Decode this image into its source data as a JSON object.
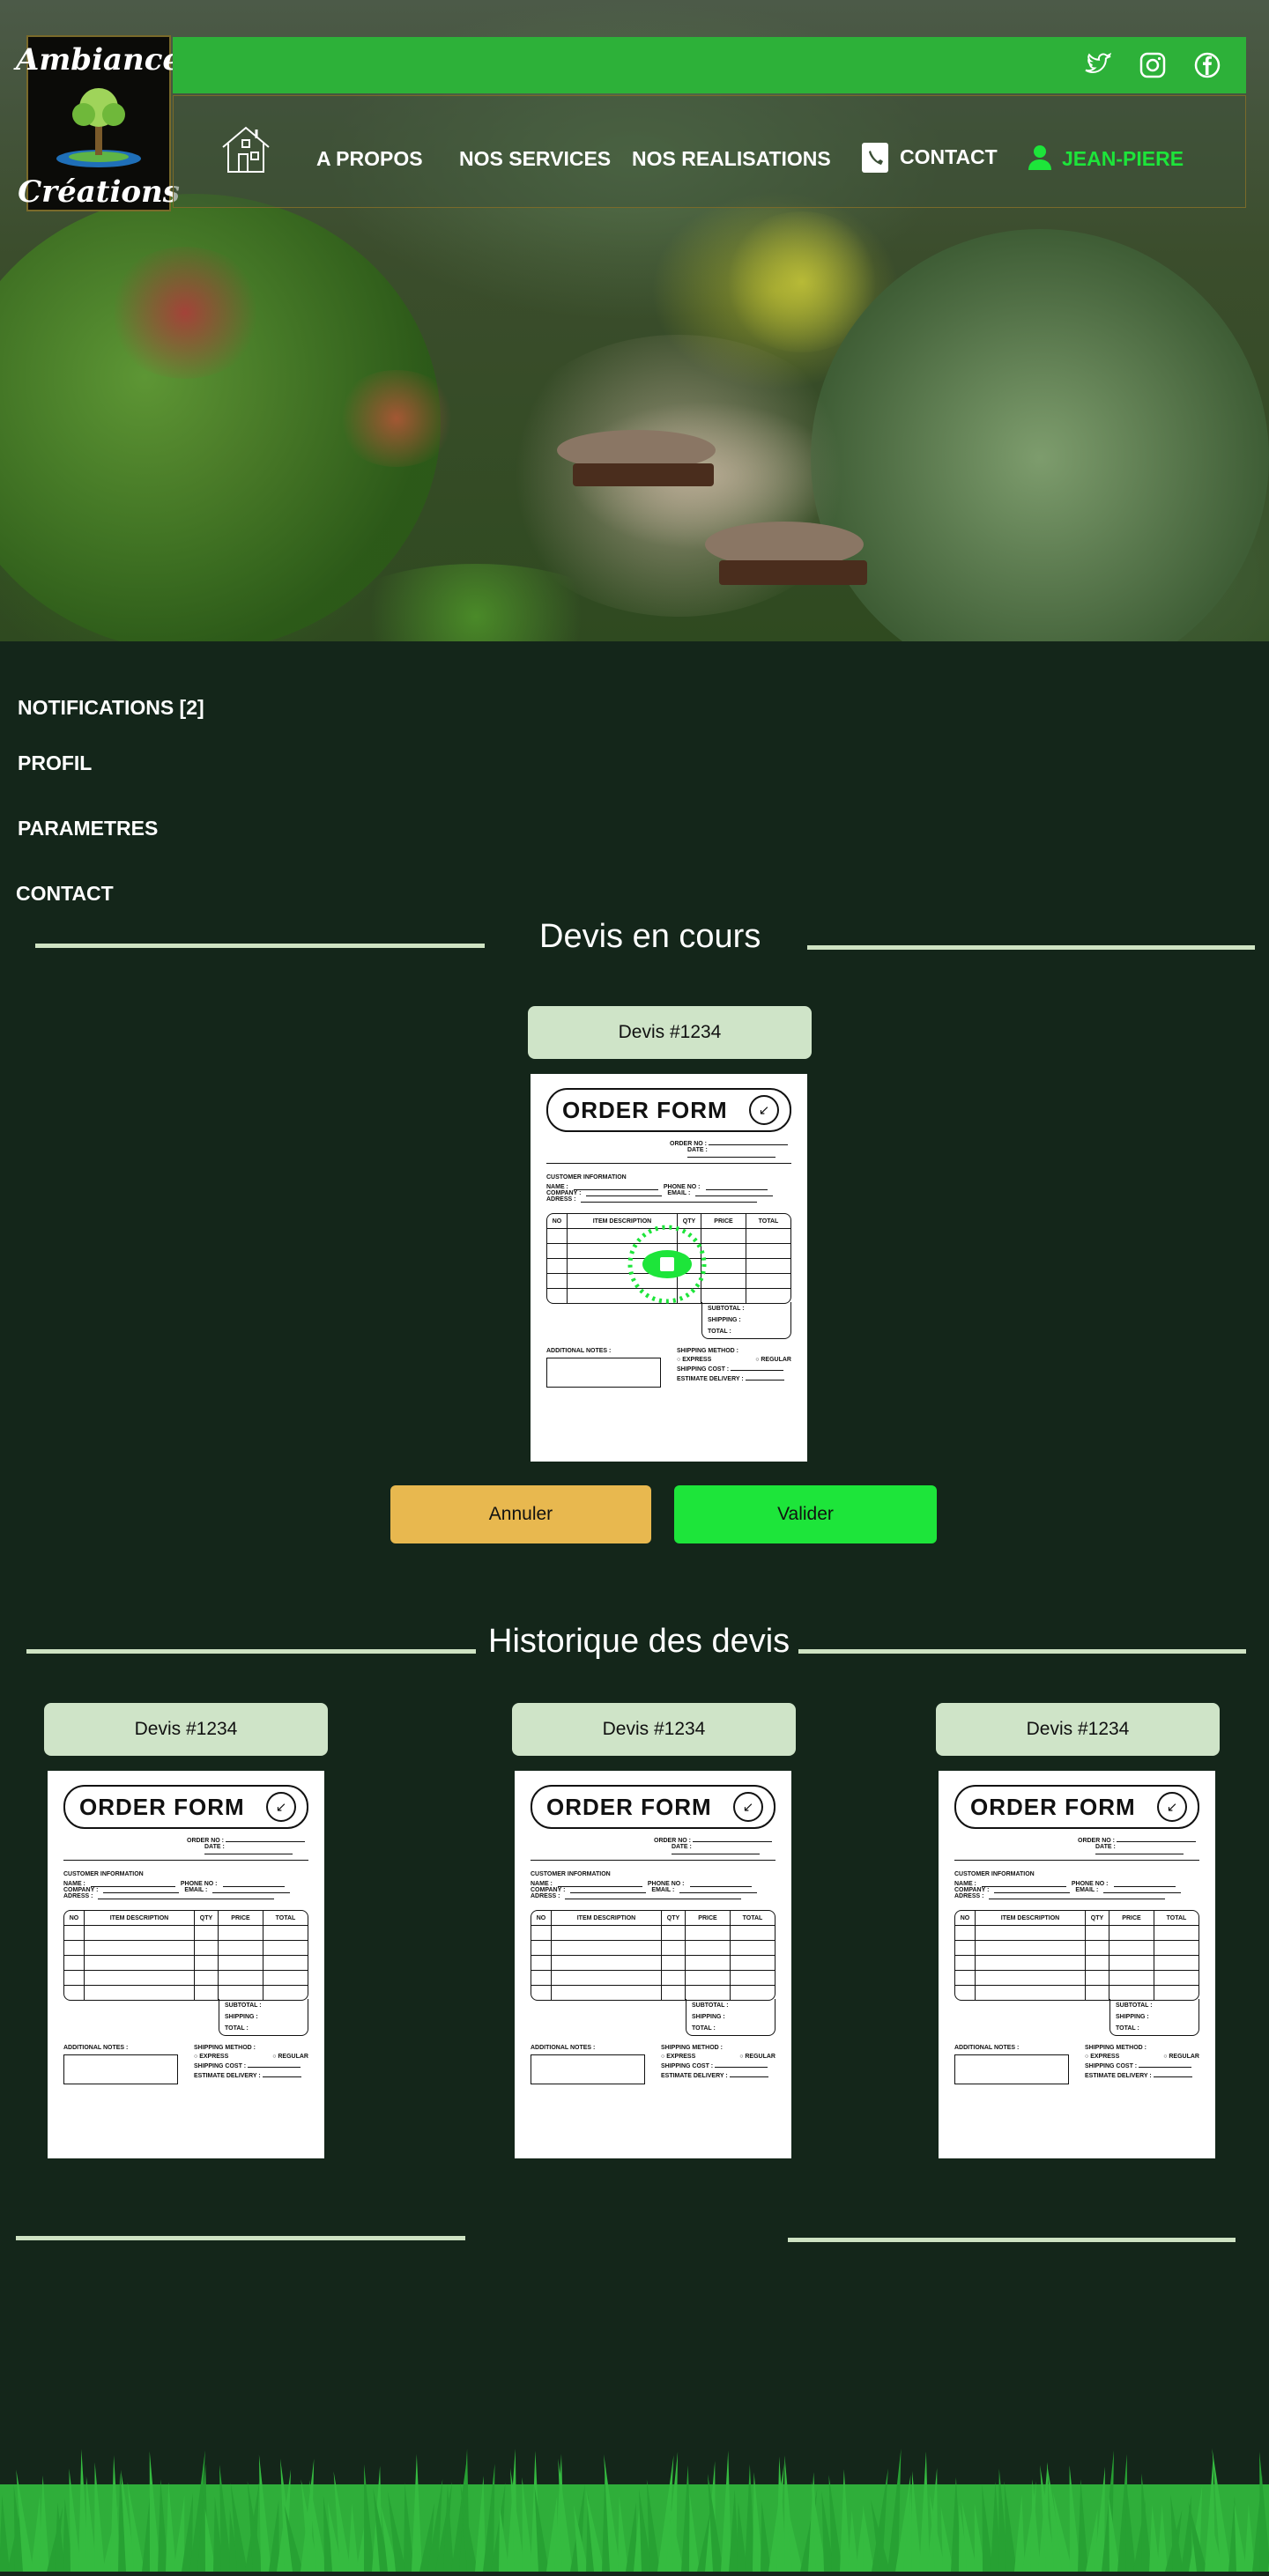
{
  "brand": {
    "logo_line1": "Ambiance",
    "logo_line2": "Créations"
  },
  "social": [
    {
      "icon": "twitter-icon"
    },
    {
      "icon": "instagram-icon"
    },
    {
      "icon": "facebook-icon"
    }
  ],
  "nav": {
    "home_icon": "home-icon",
    "apropos": "A PROPOS",
    "services": "NOS SERVICES",
    "realisations": "NOS REALISATIONS",
    "contact": "CONTACT",
    "user": "JEAN-PIERE"
  },
  "sidebar": {
    "notifications": "NOTIFICATIONS [2]",
    "profil": "PROFIL",
    "parametres": "PARAMETRES",
    "contact": "CONTACT"
  },
  "current": {
    "title": "Devis en cours",
    "devis_label": "Devis #1234",
    "cancel": "Annuler",
    "validate": "Valider"
  },
  "history": {
    "title": "Historique des devis",
    "items": [
      {
        "label": "Devis #1234"
      },
      {
        "label": "Devis #1234"
      },
      {
        "label": "Devis #1234"
      }
    ]
  },
  "form": {
    "title": "ORDER FORM",
    "order_no": "ORDER NO :",
    "date": "DATE :",
    "customer_info": "CUSTOMER INFORMATION",
    "name": "NAME :",
    "phone": "PHONE NO :",
    "company": "COMPANY :",
    "email": "EMAIL :",
    "adress": "ADRESS :",
    "col_no": "NO",
    "col_desc": "ITEM DESCRIPTION",
    "col_qty": "QTY",
    "col_price": "PRICE",
    "col_total": "TOTAL",
    "subtotal": "SUBTOTAL :",
    "shipping": "SHIPPING :",
    "total": "TOTAL :",
    "notes": "ADDITIONAL NOTES :",
    "shipping_method": "SHIPPING METHOD :",
    "express": "EXPRESS",
    "regular": "REGULAR",
    "shipping_cost": "SHIPPING COST :",
    "estimate": "ESTIMATE DELIVERY :"
  },
  "colors": {
    "bg": "#14261a",
    "topbar": "#2db139",
    "accent": "#1de53a",
    "cancel": "#e8b84f",
    "tag": "#cfe4c8"
  }
}
